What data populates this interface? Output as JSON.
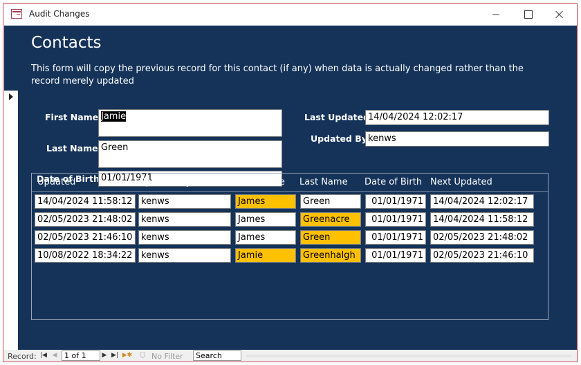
{
  "window": {
    "title": "Audit Changes"
  },
  "form": {
    "title": "Contacts",
    "description": "This form will copy the previous record for this contact (if any) when data is actually changed rather than the record merely updated"
  },
  "fields": {
    "first_name_label": "First Name:",
    "first_name": "Jamie",
    "last_name_label": "Last Name:",
    "last_name": "Green",
    "dob_label": "Date of Birth:",
    "dob": "01/01/1971",
    "last_updated_label": "Last Updated:",
    "last_updated": "14/04/2024 12:02:17",
    "updated_by_label": "Updated By:",
    "updated_by": "kenws"
  },
  "history": {
    "headers": [
      "Updated",
      "Updated by",
      "First Name",
      "Last Name",
      "Date of Birth",
      "Next Updated"
    ],
    "rows": [
      {
        "updated": "14/04/2024 11:58:12",
        "updated_by": "kenws",
        "first_name": "James",
        "last_name": "Green",
        "dob": "01/01/1971",
        "next_updated": "14/04/2024 12:02:17",
        "hl_first": true,
        "hl_last": false
      },
      {
        "updated": "02/05/2023 21:48:02",
        "updated_by": "kenws",
        "first_name": "James",
        "last_name": "Greenacre",
        "dob": "01/01/1971",
        "next_updated": "14/04/2024 11:58:12",
        "hl_first": false,
        "hl_last": true
      },
      {
        "updated": "02/05/2023 21:46:10",
        "updated_by": "kenws",
        "first_name": "James",
        "last_name": "Green",
        "dob": "01/01/1971",
        "next_updated": "02/05/2023 21:48:02",
        "hl_first": false,
        "hl_last": true
      },
      {
        "updated": "10/08/2022 18:34:22",
        "updated_by": "kenws",
        "first_name": "Jamie",
        "last_name": "Greenhalgh",
        "dob": "01/01/1971",
        "next_updated": "02/05/2023 21:46:10",
        "hl_first": true,
        "hl_last": true
      }
    ]
  },
  "navigation": {
    "record_label": "Record:",
    "position": "1 of 1",
    "filter_label": "No Filter",
    "search": "Search"
  },
  "colors": {
    "form_background": "#153359",
    "highlight": "#ffc000"
  }
}
